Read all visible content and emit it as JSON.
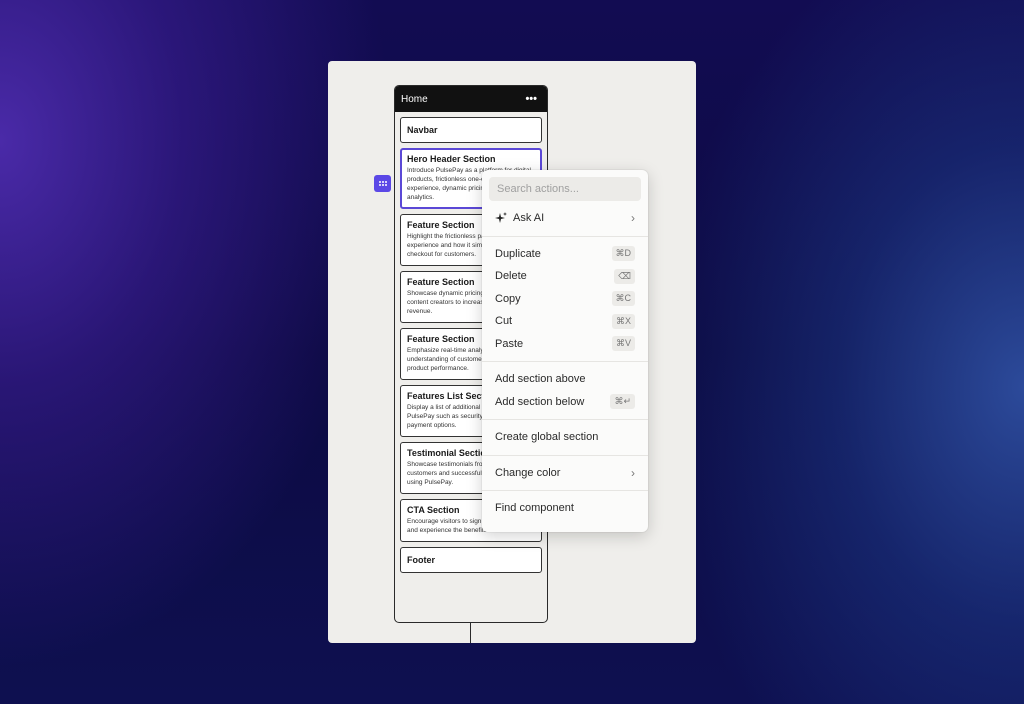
{
  "panel": {
    "title": "Home",
    "more_icon": "ellipsis-icon",
    "sections": [
      {
        "title": "Navbar",
        "desc": ""
      },
      {
        "title": "Hero Header Section",
        "desc": "Introduce PulsePay as a platform for digital products, frictionless one-click payment experience, dynamic pricing and real-time analytics.",
        "selected": true
      },
      {
        "title": "Feature Section",
        "desc": "Highlight the frictionless payment experience and how it simplifies the checkout for customers."
      },
      {
        "title": "Feature Section",
        "desc": "Showcase dynamic pricing available for content creators to increase sales and revenue."
      },
      {
        "title": "Feature Section",
        "desc": "Emphasize real-time analytics for better understanding of customer behavior and product performance."
      },
      {
        "title": "Features List Section",
        "desc": "Display a list of additional benefits of using PulsePay such as security, ease of use, and payment options."
      },
      {
        "title": "Testimonial Section",
        "desc": "Showcase testimonials from satisfied customers and successful content creators using PulsePay."
      },
      {
        "title": "CTA Section",
        "desc": "Encourage visitors to sign up for PulsePay and experience the benefits firsthand."
      },
      {
        "title": "Footer",
        "desc": ""
      }
    ]
  },
  "menu": {
    "search_placeholder": "Search actions...",
    "ask_ai": "Ask AI",
    "groups": [
      [
        {
          "label": "Duplicate",
          "shortcut": "⌘D"
        },
        {
          "label": "Delete",
          "shortcut": "⌫"
        },
        {
          "label": "Copy",
          "shortcut": "⌘C"
        },
        {
          "label": "Cut",
          "shortcut": "⌘X"
        },
        {
          "label": "Paste",
          "shortcut": "⌘V"
        }
      ],
      [
        {
          "label": "Add section above",
          "shortcut": ""
        },
        {
          "label": "Add section below",
          "shortcut": "⌘↵"
        }
      ],
      [
        {
          "label": "Create global section",
          "shortcut": ""
        }
      ],
      [
        {
          "label": "Change color",
          "submenu": true
        }
      ],
      [
        {
          "label": "Find component",
          "shortcut": ""
        }
      ]
    ]
  },
  "colors": {
    "accent": "#5b48e6",
    "selected_border": "#5b48d6"
  }
}
